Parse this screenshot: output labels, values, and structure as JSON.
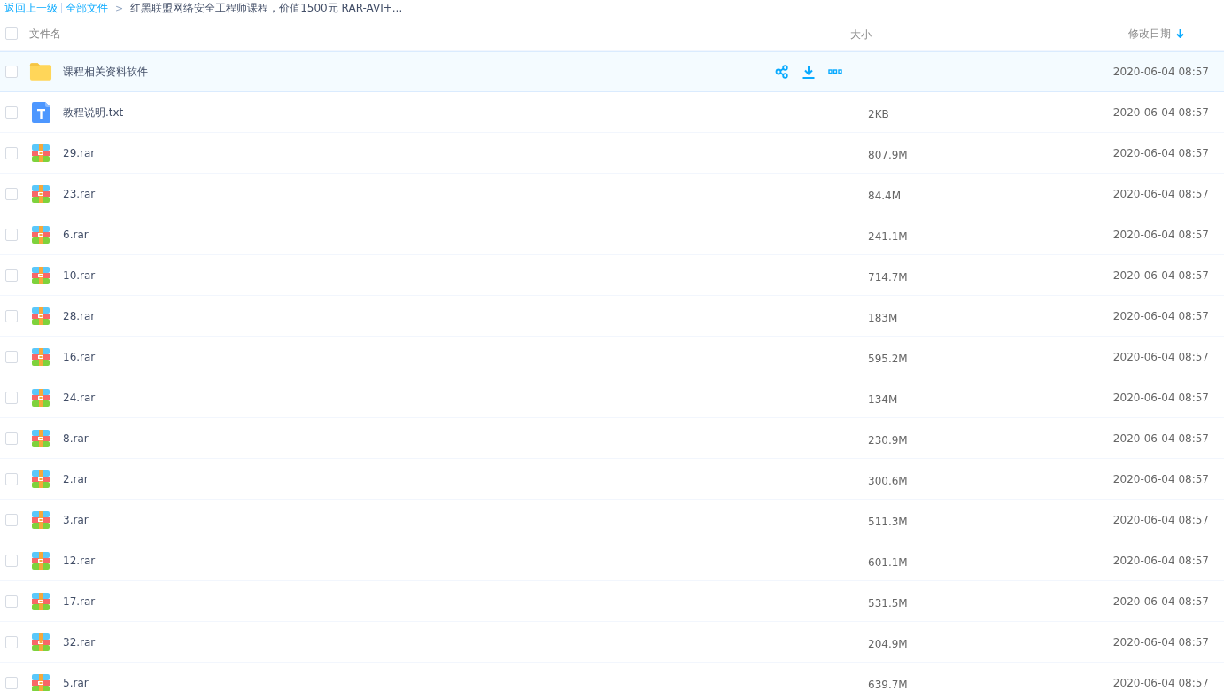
{
  "breadcrumb": {
    "back": "返回上一级",
    "root": "全部文件",
    "separator": ">",
    "current": "红黑联盟网络安全工程师课程，价值1500元 RAR-AVI+..."
  },
  "table": {
    "select_all_checked": false,
    "columns": [
      {
        "label": "文件名"
      },
      {
        "label": "大小"
      },
      {
        "label": "修改日期",
        "sorted": true
      }
    ],
    "rows": [
      {
        "kind": "folder",
        "name": "课程相关资料软件",
        "size": "-",
        "date": "2020-06-04 08:57",
        "hovered": true,
        "checked": false
      },
      {
        "kind": "text",
        "name": "教程说明.txt",
        "size": "2KB",
        "date": "2020-06-04 08:57",
        "hovered": false,
        "checked": false
      },
      {
        "kind": "archive",
        "name": "29.rar",
        "size": "807.9M",
        "date": "2020-06-04 08:57",
        "hovered": false,
        "checked": false
      },
      {
        "kind": "archive",
        "name": "23.rar",
        "size": "84.4M",
        "date": "2020-06-04 08:57",
        "hovered": false,
        "checked": false
      },
      {
        "kind": "archive",
        "name": "6.rar",
        "size": "241.1M",
        "date": "2020-06-04 08:57",
        "hovered": false,
        "checked": false
      },
      {
        "kind": "archive",
        "name": "10.rar",
        "size": "714.7M",
        "date": "2020-06-04 08:57",
        "hovered": false,
        "checked": false
      },
      {
        "kind": "archive",
        "name": "28.rar",
        "size": "183M",
        "date": "2020-06-04 08:57",
        "hovered": false,
        "checked": false
      },
      {
        "kind": "archive",
        "name": "16.rar",
        "size": "595.2M",
        "date": "2020-06-04 08:57",
        "hovered": false,
        "checked": false
      },
      {
        "kind": "archive",
        "name": "24.rar",
        "size": "134M",
        "date": "2020-06-04 08:57",
        "hovered": false,
        "checked": false
      },
      {
        "kind": "archive",
        "name": "8.rar",
        "size": "230.9M",
        "date": "2020-06-04 08:57",
        "hovered": false,
        "checked": false
      },
      {
        "kind": "archive",
        "name": "2.rar",
        "size": "300.6M",
        "date": "2020-06-04 08:57",
        "hovered": false,
        "checked": false
      },
      {
        "kind": "archive",
        "name": "3.rar",
        "size": "511.3M",
        "date": "2020-06-04 08:57",
        "hovered": false,
        "checked": false
      },
      {
        "kind": "archive",
        "name": "12.rar",
        "size": "601.1M",
        "date": "2020-06-04 08:57",
        "hovered": false,
        "checked": false
      },
      {
        "kind": "archive",
        "name": "17.rar",
        "size": "531.5M",
        "date": "2020-06-04 08:57",
        "hovered": false,
        "checked": false
      },
      {
        "kind": "archive",
        "name": "32.rar",
        "size": "204.9M",
        "date": "2020-06-04 08:57",
        "hovered": false,
        "checked": false
      },
      {
        "kind": "archive",
        "name": "5.rar",
        "size": "639.7M",
        "date": "2020-06-04 08:57",
        "hovered": false,
        "checked": false
      }
    ]
  }
}
